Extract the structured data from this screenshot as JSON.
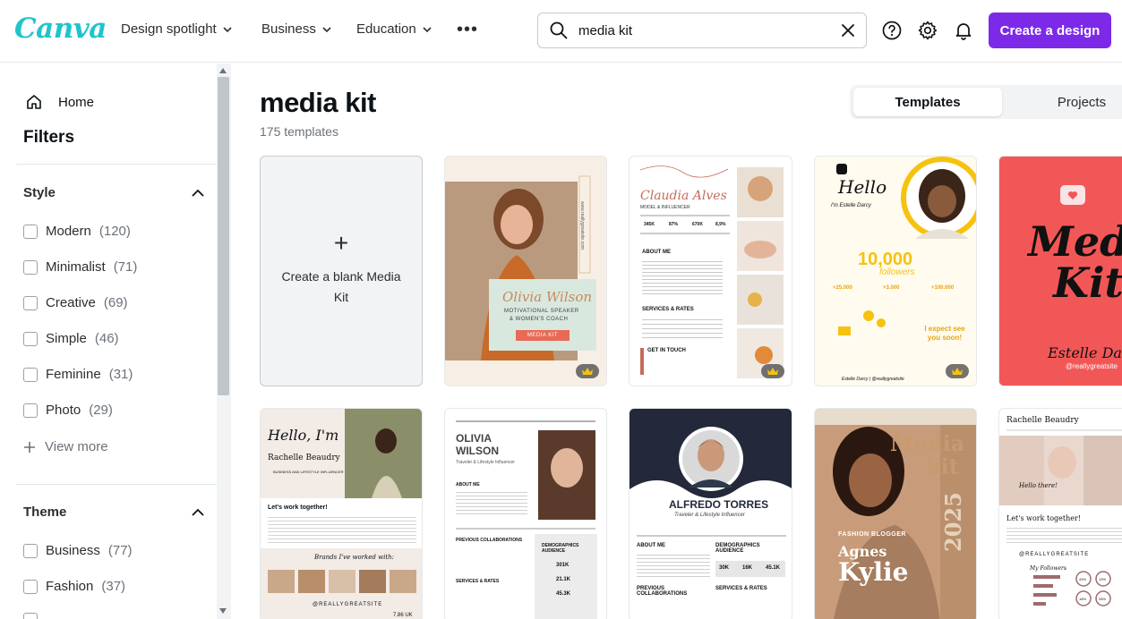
{
  "header": {
    "logo": "Canva",
    "nav": [
      "Design spotlight",
      "Business",
      "Education"
    ],
    "more_icon": "more-horizontal-icon",
    "search_value": "media kit",
    "create_button": "Create a design",
    "icons": [
      "help-icon",
      "gear-icon",
      "bell-icon"
    ]
  },
  "sidebar": {
    "home": "Home",
    "filters_title": "Filters",
    "style_title": "Style",
    "style_items": [
      {
        "label": "Modern",
        "count": "(120)"
      },
      {
        "label": "Minimalist",
        "count": "(71)"
      },
      {
        "label": "Creative",
        "count": "(69)"
      },
      {
        "label": "Simple",
        "count": "(46)"
      },
      {
        "label": "Feminine",
        "count": "(31)"
      },
      {
        "label": "Photo",
        "count": "(29)"
      }
    ],
    "view_more": "View more",
    "theme_title": "Theme",
    "theme_items": [
      {
        "label": "Business",
        "count": "(77)"
      },
      {
        "label": "Fashion",
        "count": "(37)"
      }
    ]
  },
  "main": {
    "title": "media kit",
    "count": "175 templates",
    "tabs": [
      "Templates",
      "Projects"
    ],
    "blank_card": "Create a blank Media Kit",
    "cards": {
      "olivia": {
        "name": "Olivia Wilson",
        "role1": "MOTIVATIONAL SPEAKER",
        "role2": "& WOMEN'S COACH",
        "tag": "MEDIA KIT",
        "site": "www.reallygreatsite.com"
      },
      "claudia": {
        "name": "Claudia Alves",
        "sub": "MODEL & INFLUENCER",
        "stats": [
          "345K",
          "87%",
          "670K",
          "8,9%"
        ],
        "about": "ABOUT ME",
        "services": "SERVICES & RATES",
        "contact": "GET IN TOUCH"
      },
      "estelle": {
        "hello": "Hello",
        "name": "I'm Estelle Darcy",
        "followers_num": "10,000",
        "followers_label": "followers",
        "stat1": "+25.000",
        "stat2": "+3.000",
        "stat3": "+100.000",
        "cta": "I expect see you soon!",
        "signature": "Estelle Darcy | @reallygreatsite"
      },
      "red": {
        "title1": "Media",
        "title2": "Kit",
        "name": "Estelle Darcy",
        "handle": "@reallygreatsite"
      },
      "rachelle": {
        "hello": "Hello, I'm",
        "name": "Rachelle Beaudry",
        "sub": "BUSINESS AND LIFESTYLE INFLUENCER",
        "cta": "Let's work together!",
        "brands": "Brands I've worked with:",
        "handle": "@REALLYGREATSITE",
        "stat": "7.86 UK"
      },
      "olivia2": {
        "name1": "OLIVIA",
        "name2": "WILSON",
        "sub": "Traveler & Lifestyle Influencer",
        "about": "ABOUT ME",
        "prev": "PREVIOUS COLLABORATIONS",
        "services": "SERVICES & RATES",
        "demo": "DEMOGRAPHICS AUDIENCE",
        "s1": "301K",
        "s2": "21.1K",
        "s3": "45.3K"
      },
      "alfredo": {
        "name": "ALFREDO TORRES",
        "sub": "Traveler & Lifestyle Influencer",
        "about": "ABOUT ME",
        "demo": "DEMOGRAPHICS AUDIENCE",
        "prev": "PREVIOUS COLLABORATIONS",
        "services": "SERVICES & RATES",
        "s1": "30K",
        "s2": "16K",
        "s3": "45.1K"
      },
      "kylie": {
        "title1": "Media",
        "title2": "kit",
        "tag": "FASHION BLOGGER",
        "first": "Agnes",
        "last": "Kylie",
        "year": "2025"
      },
      "rachelle2": {
        "name": "Rachelle Beaudry",
        "hello": "Hello there!",
        "cta": "Let's work together!",
        "handle": "@REALLYGREATSITE",
        "followers": "My Followers",
        "p1": "43%",
        "p2": "13%",
        "p3": "18%",
        "p4": "28%"
      }
    }
  },
  "colors": {
    "accent": "#7d2ae8",
    "logo": "#20c4cb",
    "red_card": "#f25757",
    "yellow": "#f6c20f"
  }
}
